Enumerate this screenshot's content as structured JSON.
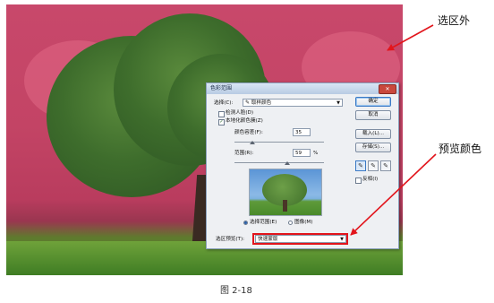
{
  "dialog": {
    "title": "色彩范围",
    "close_label": "✕",
    "select_label": "选择(C):",
    "select_value": "取样颜色",
    "detect_faces_label": "检测人脸(D)",
    "localized_label": "本地化颜色簇(Z)",
    "fuzziness_label": "颜色容差(F):",
    "fuzziness_value": "35",
    "range_label": "范围(R):",
    "range_value": "59",
    "range_unit": "%",
    "radio_selection_label": "选择范围(E)",
    "radio_image_label": "图像(M)",
    "preview_label": "选区预览(T):",
    "preview_value": "快速蒙版",
    "ok_label": "确定",
    "cancel_label": "取消",
    "load_label": "载入(L)...",
    "save_label": "存储(S)...",
    "invert_label": "反相(I)",
    "detect_faces_checked": false,
    "localized_checked": true,
    "invert_checked": false,
    "fuzziness_level": 0.2,
    "range_level": 0.59
  },
  "annotations": {
    "outside_label": "选区外",
    "preview_color_label": "预览颜色"
  },
  "caption": "图 2-18",
  "colors": {
    "mask": "#c8486b",
    "highlight_box": "#e2151c",
    "arrow": "#e2151c"
  }
}
